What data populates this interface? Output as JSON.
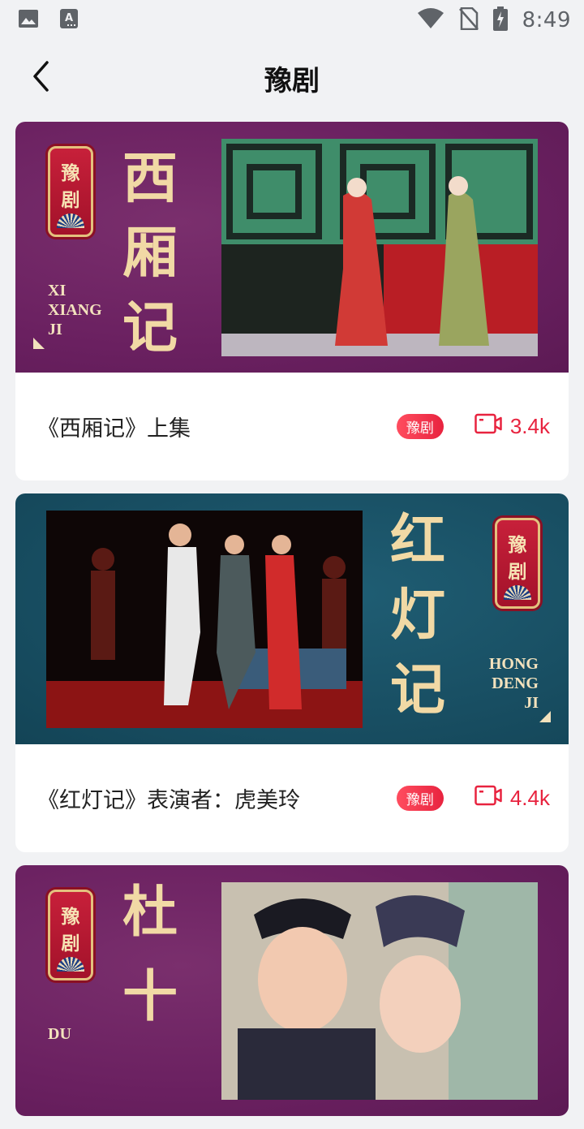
{
  "status_bar": {
    "time": "8:49",
    "left_icons": [
      "image-icon",
      "keyboard-icon"
    ],
    "right_icons": [
      "wifi-icon",
      "no-sim-icon",
      "battery-charging-icon"
    ]
  },
  "header": {
    "title": "豫剧",
    "back_icon": "chevron-left-icon"
  },
  "colors": {
    "accent": "#e8233f",
    "purple_banner": "#6a2060",
    "teal_banner": "#184e62",
    "gold_text": "#f1d9a5"
  },
  "cards": [
    {
      "title": "《西厢记》上集",
      "tag": "豫剧",
      "views": "3.4k",
      "banner": {
        "seal_top": "豫",
        "seal_bottom": "剧",
        "calligraphy": [
          "西",
          "厢",
          "记"
        ],
        "pinyin": [
          "XI",
          "XIANG",
          "JI"
        ]
      }
    },
    {
      "title": "《红灯记》表演者：虎美玲",
      "tag": "豫剧",
      "views": "4.4k",
      "banner": {
        "seal_top": "豫",
        "seal_bottom": "剧",
        "calligraphy": [
          "红",
          "灯",
          "记"
        ],
        "pinyin": [
          "HONG",
          "DENG",
          "JI"
        ]
      }
    },
    {
      "banner": {
        "seal_top": "豫",
        "seal_bottom": "剧",
        "calligraphy": [
          "杜",
          "十"
        ],
        "pinyin": [
          "DU"
        ]
      }
    }
  ]
}
